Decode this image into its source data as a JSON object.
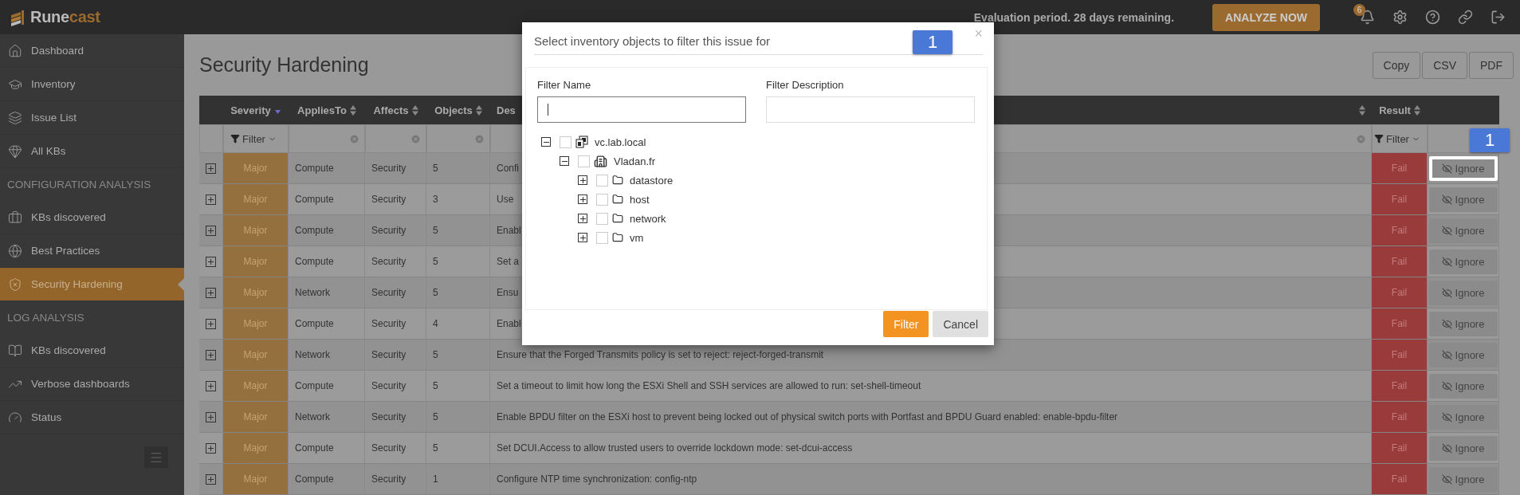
{
  "topbar": {
    "logo": {
      "first": "Rune",
      "second": "cast"
    },
    "notice": "Evaluation period. 28 days remaining.",
    "analyze_button": "ANALYZE NOW",
    "notifications": "6"
  },
  "sidebar": {
    "sections": [
      {
        "items": [
          {
            "label": "Dashboard",
            "selected": false
          },
          {
            "label": "Inventory",
            "selected": false
          },
          {
            "label": "Issue List",
            "selected": false
          },
          {
            "label": "All KBs",
            "selected": false
          }
        ]
      },
      {
        "heading": "CONFIGURATION ANALYSIS",
        "items": [
          {
            "label": "KBs discovered",
            "selected": false
          },
          {
            "label": "Best Practices",
            "selected": false
          },
          {
            "label": "Security Hardening",
            "selected": true
          }
        ]
      },
      {
        "heading": "LOG ANALYSIS",
        "items": [
          {
            "label": "KBs discovered",
            "selected": false
          },
          {
            "label": "Verbose dashboards",
            "selected": false
          },
          {
            "label": "Status",
            "selected": false
          }
        ]
      }
    ]
  },
  "page": {
    "title": "Security Hardening",
    "export_buttons": [
      "Copy",
      "CSV",
      "PDF"
    ]
  },
  "table": {
    "annotation": "1",
    "columns": [
      {
        "label": "Severity",
        "sorted": true,
        "filter_label": "Filter"
      },
      {
        "label": "AppliesTo",
        "sorted": false
      },
      {
        "label": "Affects",
        "sorted": false
      },
      {
        "label": "Objects",
        "sorted": false
      },
      {
        "label": "Des",
        "sorted": false
      },
      {
        "label": "Result",
        "sorted": false,
        "filter_label": "Filter"
      }
    ],
    "rows": [
      {
        "expanded": false,
        "severity": "Major",
        "applies_to": "Compute",
        "affects": "Security",
        "objects": "5",
        "description": "Confi",
        "result": "Fail",
        "action": "Ignore",
        "highlighted": true
      },
      {
        "expanded": false,
        "severity": "Major",
        "applies_to": "Compute",
        "affects": "Security",
        "objects": "3",
        "description": "Use",
        "result": "Fail",
        "action": "Ignore",
        "highlighted": false
      },
      {
        "expanded": false,
        "severity": "Major",
        "applies_to": "Compute",
        "affects": "Security",
        "objects": "5",
        "description": "Enabl",
        "result": "Fail",
        "action": "Ignore",
        "highlighted": false
      },
      {
        "expanded": false,
        "severity": "Major",
        "applies_to": "Compute",
        "affects": "Security",
        "objects": "5",
        "description": "Set a",
        "result": "Fail",
        "action": "Ignore",
        "highlighted": false
      },
      {
        "expanded": false,
        "severity": "Major",
        "applies_to": "Network",
        "affects": "Security",
        "objects": "5",
        "description": "Ensu",
        "result": "Fail",
        "action": "Ignore",
        "highlighted": false
      },
      {
        "expanded": false,
        "severity": "Major",
        "applies_to": "Compute",
        "affects": "Security",
        "objects": "4",
        "description": "Enabl",
        "result": "Fail",
        "action": "Ignore",
        "highlighted": false
      },
      {
        "expanded": false,
        "severity": "Major",
        "applies_to": "Network",
        "affects": "Security",
        "objects": "5",
        "description": "Ensure that the Forged Transmits policy is set to reject: reject-forged-transmit",
        "result": "Fail",
        "action": "Ignore",
        "highlighted": false
      },
      {
        "expanded": false,
        "severity": "Major",
        "applies_to": "Compute",
        "affects": "Security",
        "objects": "5",
        "description": "Set a timeout to limit how long the ESXi Shell and SSH services are allowed to run: set-shell-timeout",
        "result": "Fail",
        "action": "Ignore",
        "highlighted": false
      },
      {
        "expanded": false,
        "severity": "Major",
        "applies_to": "Network",
        "affects": "Security",
        "objects": "5",
        "description": "Enable BPDU filter on the ESXi host to prevent being locked out of physical switch ports with Portfast and BPDU Guard enabled: enable-bpdu-filter",
        "result": "Fail",
        "action": "Ignore",
        "highlighted": false
      },
      {
        "expanded": false,
        "severity": "Major",
        "applies_to": "Compute",
        "affects": "Security",
        "objects": "5",
        "description": "Set DCUI.Access to allow trusted users to  override lockdown mode: set-dcui-access",
        "result": "Fail",
        "action": "Ignore",
        "highlighted": false
      },
      {
        "expanded": false,
        "severity": "Major",
        "applies_to": "Compute",
        "affects": "Security",
        "objects": "1",
        "description": "Configure NTP time synchronization: config-ntp",
        "result": "Fail",
        "action": "Ignore",
        "highlighted": false
      }
    ]
  },
  "modal": {
    "title": "Select inventory objects to filter this issue for",
    "close": "×",
    "filter_name": {
      "label": "Filter Name",
      "focused": true
    },
    "filter_description": {
      "label": "Filter Description"
    },
    "tree": [
      {
        "label": "vc.lab.local",
        "kind": "vcenter",
        "expanded": true,
        "checked": false,
        "children": [
          {
            "label": "Vladan.fr",
            "kind": "datacenter",
            "expanded": true,
            "checked": false,
            "children": [
              {
                "label": "datastore",
                "kind": "folder",
                "expanded": false,
                "checked": false
              },
              {
                "label": "host",
                "kind": "folder",
                "expanded": false,
                "checked": false
              },
              {
                "label": "network",
                "kind": "folder",
                "expanded": false,
                "checked": false
              },
              {
                "label": "vm",
                "kind": "folder",
                "expanded": false,
                "checked": false
              }
            ]
          }
        ]
      }
    ],
    "buttons": [
      {
        "label": "Filter",
        "kind": "primary"
      },
      {
        "label": "Cancel",
        "kind": "secondary"
      }
    ],
    "annotation": "1"
  }
}
